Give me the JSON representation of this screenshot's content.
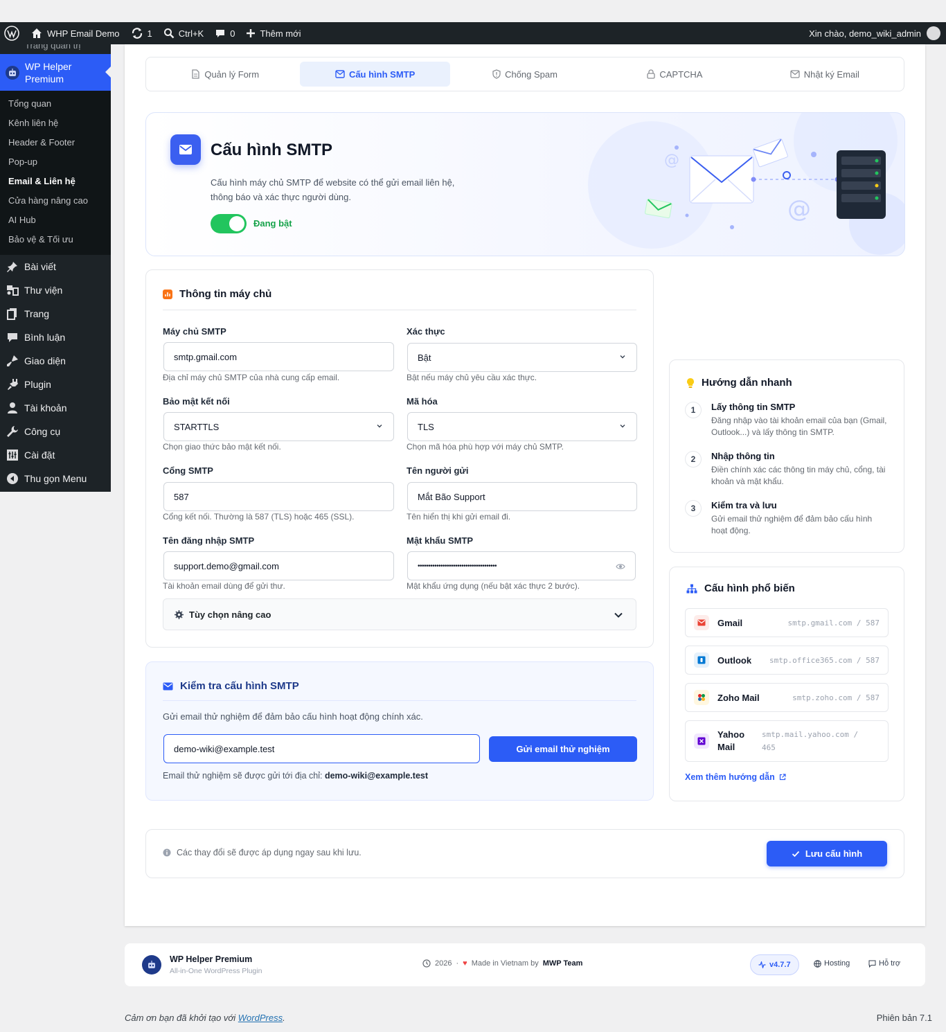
{
  "adminbar": {
    "site_name": "WHP Email Demo",
    "updates_count": "1",
    "search_shortcut": "Ctrl+K",
    "comments_count": "0",
    "new_label": "Thêm mới",
    "greeting": "Xin chào, demo_wiki_admin"
  },
  "sidebar": {
    "cut_item": "Trang quản trị",
    "current_plugin": "WP Helper Premium",
    "submenu": [
      {
        "label": "Tổng quan"
      },
      {
        "label": "Kênh liên hệ"
      },
      {
        "label": "Header & Footer"
      },
      {
        "label": "Pop-up"
      },
      {
        "label": "Email & Liên hệ"
      },
      {
        "label": "Cửa hàng nâng cao"
      },
      {
        "label": "AI Hub"
      },
      {
        "label": "Bảo vệ & Tối ưu"
      }
    ],
    "menu": [
      {
        "label": "Bài viết",
        "icon": "pin-icon"
      },
      {
        "label": "Thư viện",
        "icon": "media-icon"
      },
      {
        "label": "Trang",
        "icon": "page-icon"
      },
      {
        "label": "Bình luận",
        "icon": "comment-icon"
      },
      {
        "label": "Giao diện",
        "icon": "brush-icon"
      },
      {
        "label": "Plugin",
        "icon": "plugin-icon"
      },
      {
        "label": "Tài khoản",
        "icon": "user-icon"
      },
      {
        "label": "Công cụ",
        "icon": "wrench-icon"
      },
      {
        "label": "Cài đặt",
        "icon": "settings-icon"
      },
      {
        "label": "Thu gọn Menu",
        "icon": "collapse-icon"
      }
    ]
  },
  "tabs": [
    {
      "label": "Quản lý Form",
      "icon": "document-icon"
    },
    {
      "label": "Cấu hình SMTP",
      "icon": "mail-icon"
    },
    {
      "label": "Chống Spam",
      "icon": "shield-icon"
    },
    {
      "label": "CAPTCHA",
      "icon": "lock-icon"
    },
    {
      "label": "Nhật ký Email",
      "icon": "mail-log-icon"
    }
  ],
  "hero": {
    "title": "Cấu hình SMTP",
    "description": "Cấu hình máy chủ SMTP để website có thể gửi email liên hệ, thông báo và xác thực người dùng.",
    "toggle_label": "Đang bật",
    "toggle_on": true
  },
  "server": {
    "title": "Thông tin máy chủ",
    "smtp_host": {
      "label": "Máy chủ SMTP",
      "value": "smtp.gmail.com",
      "hint": "Địa chỉ máy chủ SMTP của nhà cung cấp email."
    },
    "auth": {
      "label": "Xác thực",
      "value": "Bật",
      "hint": "Bật nếu máy chủ yêu cầu xác thực."
    },
    "security": {
      "label": "Bảo mật kết nối",
      "value": "STARTTLS",
      "hint": "Chọn giao thức bảo mật kết nối."
    },
    "encryption": {
      "label": "Mã hóa",
      "value": "TLS",
      "hint": "Chọn mã hóa phù hợp với máy chủ SMTP."
    },
    "port": {
      "label": "Cổng SMTP",
      "value": "587",
      "hint": "Cổng kết nối. Thường là 587 (TLS) hoặc 465 (SSL)."
    },
    "sender": {
      "label": "Tên người gửi",
      "value": "Mắt Bão Support",
      "hint": "Tên hiển thị khi gửi email đi."
    },
    "username": {
      "label": "Tên đăng nhập SMTP",
      "value": "support.demo@gmail.com",
      "hint": "Tài khoản email dùng để gửi thư."
    },
    "password": {
      "label": "Mật khẩu SMTP",
      "value": "••••••••••••••••••••••••••••••••••••••",
      "hint": "Mật khẩu ứng dụng (nếu bật xác thực 2 bước)."
    },
    "advanced_label": "Tùy chọn nâng cao"
  },
  "test": {
    "title": "Kiểm tra cấu hình SMTP",
    "description": "Gửi email thử nghiệm để đảm bảo cấu hình hoạt động chính xác.",
    "email_value": "demo-wiki@example.test",
    "button": "Gửi email thử nghiệm",
    "note_prefix": "Email thử nghiệm sẽ được gửi tới địa chỉ:",
    "note_email": "demo-wiki@example.test"
  },
  "guide": {
    "title": "Hướng dẫn nhanh",
    "steps": [
      {
        "num": "1",
        "title": "Lấy thông tin SMTP",
        "desc": "Đăng nhập vào tài khoản email của bạn (Gmail, Outlook...) và lấy thông tin SMTP."
      },
      {
        "num": "2",
        "title": "Nhập thông tin",
        "desc": "Điền chính xác các thông tin máy chủ, cổng, tài khoản và mật khẩu."
      },
      {
        "num": "3",
        "title": "Kiểm tra và lưu",
        "desc": "Gửi email thử nghiệm để đảm bảo cấu hình hoạt động."
      }
    ]
  },
  "popular": {
    "title": "Cấu hình phổ biến",
    "providers": [
      {
        "name": "Gmail",
        "server": "smtp.gmail.com / 587",
        "color": "#ea4335"
      },
      {
        "name": "Outlook",
        "server": "smtp.office365.com / 587",
        "color": "#0078d4"
      },
      {
        "name": "Zoho Mail",
        "server": "smtp.zoho.com / 587",
        "color": "#f0b400"
      },
      {
        "name": "Yahoo Mail",
        "server": "smtp.mail.yahoo.com / 465",
        "color": "#6001d2"
      }
    ],
    "more_link": "Xem thêm hướng dẫn"
  },
  "savebar": {
    "notice": "Các thay đổi sẽ được áp dụng ngay sau khi lưu.",
    "button": "Lưu cấu hình"
  },
  "footer": {
    "plugin_name": "WP Helper Premium",
    "plugin_sub": "All-in-One WordPress Plugin",
    "year": "2026",
    "made_in": "Made in Vietnam by",
    "team": "MWP Team",
    "version": "v4.7.7",
    "hosting": "Hosting",
    "support": "Hỗ trợ"
  },
  "wp_footer": {
    "thanks_prefix": "Cảm ơn bạn đã khởi tạo với",
    "wordpress_link": "WordPress",
    "version": "Phiên bản 7.1"
  },
  "colors": {
    "accent": "#2c5cf6",
    "success": "#22c55e",
    "adminbar": "#1d2327"
  }
}
